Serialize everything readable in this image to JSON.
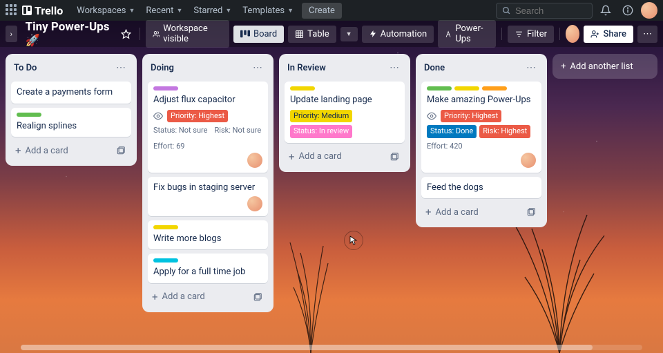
{
  "nav": {
    "logo": "Trello",
    "items": [
      "Workspaces",
      "Recent",
      "Starred",
      "Templates"
    ],
    "create": "Create",
    "search_placeholder": "Search"
  },
  "board_header": {
    "title": "Tiny Power-Ups 🚀",
    "workspace_visible": "Workspace visible",
    "board_view": "Board",
    "table_view": "Table",
    "automation": "Automation",
    "powerups": "Power-Ups",
    "filter": "Filter",
    "share": "Share"
  },
  "lists": [
    {
      "title": "To Do",
      "cards": [
        {
          "title": "Create a payments form",
          "labels": []
        },
        {
          "title": "Realign splines",
          "labels": [
            {
              "color": "#61bd4f"
            }
          ]
        }
      ]
    },
    {
      "title": "Doing",
      "cards": [
        {
          "title": "Adjust flux capacitor",
          "labels": [
            {
              "color": "#c377e0"
            }
          ],
          "watching": true,
          "badges": [
            {
              "text": "Priority: Highest",
              "bg": "#eb5a46"
            }
          ],
          "meta": [
            {
              "k": "Status",
              "v": "Not sure"
            },
            {
              "k": "Risk",
              "v": "Not sure"
            },
            {
              "k": "Effort",
              "v": "69"
            }
          ],
          "member": true
        },
        {
          "title": "Fix bugs in staging server",
          "labels": [],
          "member": true
        },
        {
          "title": "Write more blogs",
          "labels": [
            {
              "color": "#f2d600"
            }
          ]
        },
        {
          "title": "Apply for a full time job",
          "labels": [
            {
              "color": "#00c2e0"
            }
          ]
        }
      ]
    },
    {
      "title": "In Review",
      "cards": [
        {
          "title": "Update landing page",
          "labels": [
            {
              "color": "#f2d600"
            }
          ],
          "badges": [
            {
              "text": "Priority: Medium",
              "bg": "#f2d600",
              "fg": "#172b4d"
            },
            {
              "text": "Status: In review",
              "bg": "#ff78cb"
            }
          ]
        }
      ]
    },
    {
      "title": "Done",
      "cards": [
        {
          "title": "Make amazing Power-Ups",
          "labels": [
            {
              "color": "#61bd4f"
            },
            {
              "color": "#f2d600"
            },
            {
              "color": "#ff9f1a"
            }
          ],
          "watching": true,
          "badges": [
            {
              "text": "Priority: Highest",
              "bg": "#eb5a46"
            },
            {
              "text": "Status: Done",
              "bg": "#0079bf"
            },
            {
              "text": "Risk: Highest",
              "bg": "#eb5a46"
            }
          ],
          "meta": [
            {
              "k": "Effort",
              "v": "420"
            }
          ],
          "member": true
        },
        {
          "title": "Feed the dogs",
          "labels": []
        }
      ]
    }
  ],
  "add_card": "Add a card",
  "add_list": "Add another list"
}
